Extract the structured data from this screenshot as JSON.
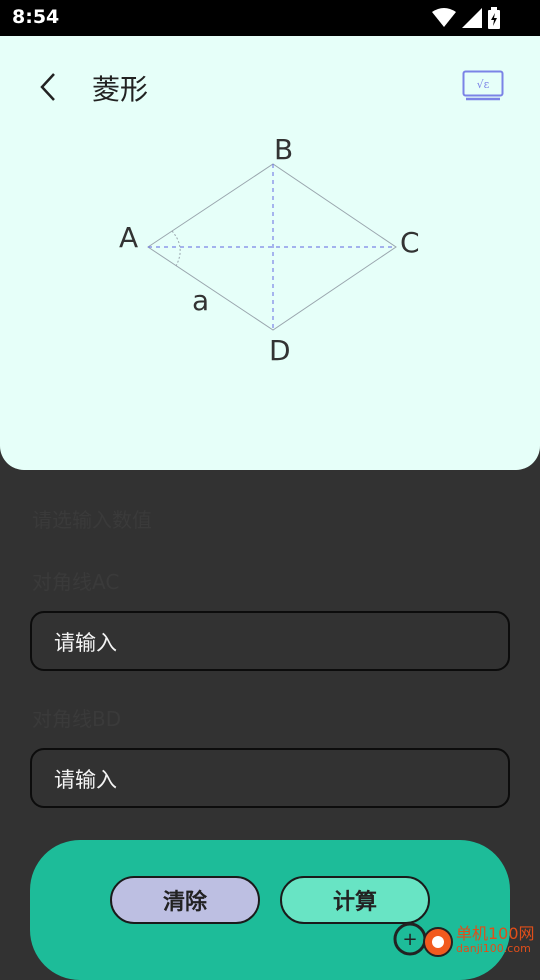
{
  "status": {
    "time": "8:54"
  },
  "header": {
    "title": "菱形",
    "formula_icon_text": "√ε"
  },
  "diagram": {
    "vertex_a": "A",
    "vertex_b": "B",
    "vertex_c": "C",
    "vertex_d": "D",
    "side_label": "a"
  },
  "form": {
    "hint": "请选输入数值",
    "field1": {
      "label": "对角线AC",
      "placeholder": "请输入"
    },
    "field2": {
      "label": "对角线BD",
      "placeholder": "请输入"
    }
  },
  "actions": {
    "clear_label": "清除",
    "calc_label": "计算"
  },
  "watermark": {
    "name": "单机100网",
    "url": "danji100.com"
  },
  "colors": {
    "card_bg": "#e6fff9",
    "panel": "#1dbc99",
    "clear_btn": "#bdbfe2",
    "calc_btn": "#68e4c4",
    "icon_accent": "#7b83e6"
  }
}
